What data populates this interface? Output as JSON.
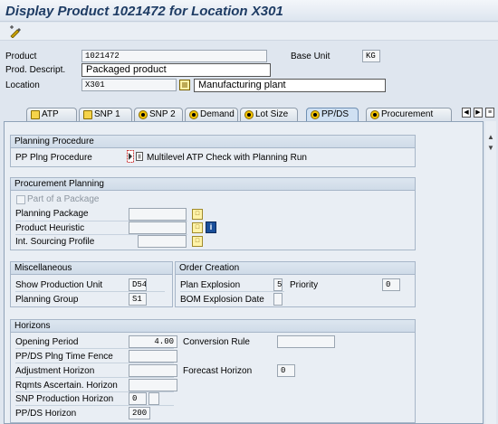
{
  "window": {
    "title": "Display Product 1021472 for Location X301"
  },
  "toolbar": {
    "icons": [
      "display-change-icon"
    ]
  },
  "header": {
    "product_label": "Product",
    "product_value": "1021472",
    "base_unit_label": "Base Unit",
    "base_unit_value": "KG",
    "descript_label": "Prod. Descript.",
    "descript_value": "Packaged product",
    "location_label": "Location",
    "location_value": "X301",
    "location_desc": "Manufacturing plant"
  },
  "tabs": [
    {
      "label": "ATP",
      "active": false
    },
    {
      "label": "SNP 1",
      "active": false
    },
    {
      "label": "SNP 2",
      "active": false
    },
    {
      "label": "Demand",
      "active": false
    },
    {
      "label": "Lot Size",
      "active": false
    },
    {
      "label": "PP/DS",
      "active": true
    },
    {
      "label": "Procurement",
      "active": false
    }
  ],
  "planning_procedure": {
    "heading": "Planning Procedure",
    "pp_plng_label": "PP Plng Procedure",
    "pp_plng_value": "Multilevel ATP Check with Planning Run"
  },
  "procurement_planning": {
    "heading": "Procurement Planning",
    "part_of_package_label": "Part of a Package",
    "part_of_package_checked": false,
    "planning_package_label": "Planning Package",
    "product_heuristic_label": "Product Heuristic",
    "int_sourcing_label": "Int. Sourcing Profile"
  },
  "miscellaneous": {
    "heading": "Miscellaneous",
    "show_prod_unit_label": "Show Production Unit",
    "show_prod_unit_value": "D54",
    "planning_group_label": "Planning Group",
    "planning_group_value": "S1"
  },
  "order_creation": {
    "heading": "Order Creation",
    "plan_explosion_label": "Plan Explosion",
    "plan_explosion_value": "5",
    "priority_label": "Priority",
    "priority_value": "0",
    "bom_explosion_label": "BOM Explosion Date"
  },
  "horizons": {
    "heading": "Horizons",
    "opening_period_label": "Opening Period",
    "opening_period_value": "4.00",
    "conversion_rule_label": "Conversion Rule",
    "ppds_fence_label": "PP/DS Plng Time Fence",
    "adjustment_label": "Adjustment Horizon",
    "forecast_label": "Forecast Horizon",
    "forecast_value": "0",
    "rqmts_label": "Rqmts Ascertain. Horizon",
    "snp_prod_label": "SNP Production Horizon",
    "snp_prod_value": "0",
    "ppds_horizon_label": "PP/DS Horizon",
    "ppds_horizon_value": "200"
  }
}
